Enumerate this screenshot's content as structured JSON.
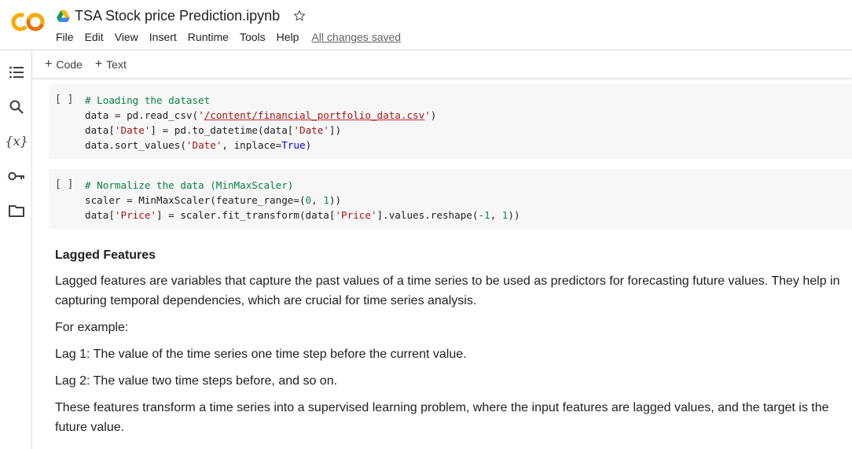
{
  "header": {
    "title": "TSA Stock price Prediction.ipynb",
    "menu": [
      "File",
      "Edit",
      "View",
      "Insert",
      "Runtime",
      "Tools",
      "Help"
    ],
    "save_status": "All changes saved",
    "logo_text": "CO"
  },
  "sidebar": {
    "icons": [
      "table-of-contents-icon",
      "search-icon",
      "variables-icon",
      "key-icon",
      "folder-icon"
    ],
    "variables_label": "{x}"
  },
  "toolbar": {
    "add_code": "Code",
    "add_text": "Text",
    "plus": "+"
  },
  "cells": [
    {
      "indicator": "[ ]",
      "lines": [
        [
          {
            "t": "# Loading the dataset",
            "c": "cm"
          }
        ],
        [
          {
            "t": "data = pd.read_csv(",
            "c": ""
          },
          {
            "t": "'",
            "c": "st"
          },
          {
            "t": "/content/financial_portfolio_data.csv",
            "c": "lnk"
          },
          {
            "t": "'",
            "c": "st"
          },
          {
            "t": ")",
            "c": ""
          }
        ],
        [
          {
            "t": "data[",
            "c": ""
          },
          {
            "t": "'Date'",
            "c": "st"
          },
          {
            "t": "] = pd.to_datetime(data[",
            "c": ""
          },
          {
            "t": "'Date'",
            "c": "st"
          },
          {
            "t": "])",
            "c": ""
          }
        ],
        [
          {
            "t": "data.sort_values(",
            "c": ""
          },
          {
            "t": "'Date'",
            "c": "st"
          },
          {
            "t": ", inplace=",
            "c": ""
          },
          {
            "t": "True",
            "c": "kw"
          },
          {
            "t": ")",
            "c": ""
          }
        ]
      ]
    },
    {
      "indicator": "[ ]",
      "lines": [
        [
          {
            "t": "# Normalize the data (MinMaxScaler)",
            "c": "cm"
          }
        ],
        [
          {
            "t": "scaler = MinMaxScaler(feature_range=(",
            "c": ""
          },
          {
            "t": "0",
            "c": "nm"
          },
          {
            "t": ", ",
            "c": ""
          },
          {
            "t": "1",
            "c": "nm"
          },
          {
            "t": "))",
            "c": ""
          }
        ],
        [
          {
            "t": "data[",
            "c": ""
          },
          {
            "t": "'Price'",
            "c": "st"
          },
          {
            "t": "] = scaler.fit_transform(data[",
            "c": ""
          },
          {
            "t": "'Price'",
            "c": "st"
          },
          {
            "t": "].values.reshape(",
            "c": ""
          },
          {
            "t": "-1",
            "c": "nm"
          },
          {
            "t": ", ",
            "c": ""
          },
          {
            "t": "1",
            "c": "nm"
          },
          {
            "t": "))",
            "c": ""
          }
        ]
      ]
    }
  ],
  "text_cell": {
    "heading": "Lagged Features",
    "paragraphs": [
      "Lagged features are variables that capture the past values of a time series to be used as predictors for forecasting future values. They help in capturing temporal dependencies, which are crucial for time series analysis.",
      "For example:",
      "Lag 1: The value of the time series one time step before the current value.",
      "Lag 2: The value two time steps before, and so on.",
      "These features transform a time series into a supervised learning problem, where the input features are lagged values, and the target is the future value."
    ]
  },
  "colors": {
    "logo_orange": "#f9ab00",
    "logo_dark_orange": "#e8710a",
    "cell_bg": "#f7f7f7",
    "comment": "#0b8043",
    "string": "#a31515",
    "number": "#098658",
    "keyword": "#0000ff"
  }
}
